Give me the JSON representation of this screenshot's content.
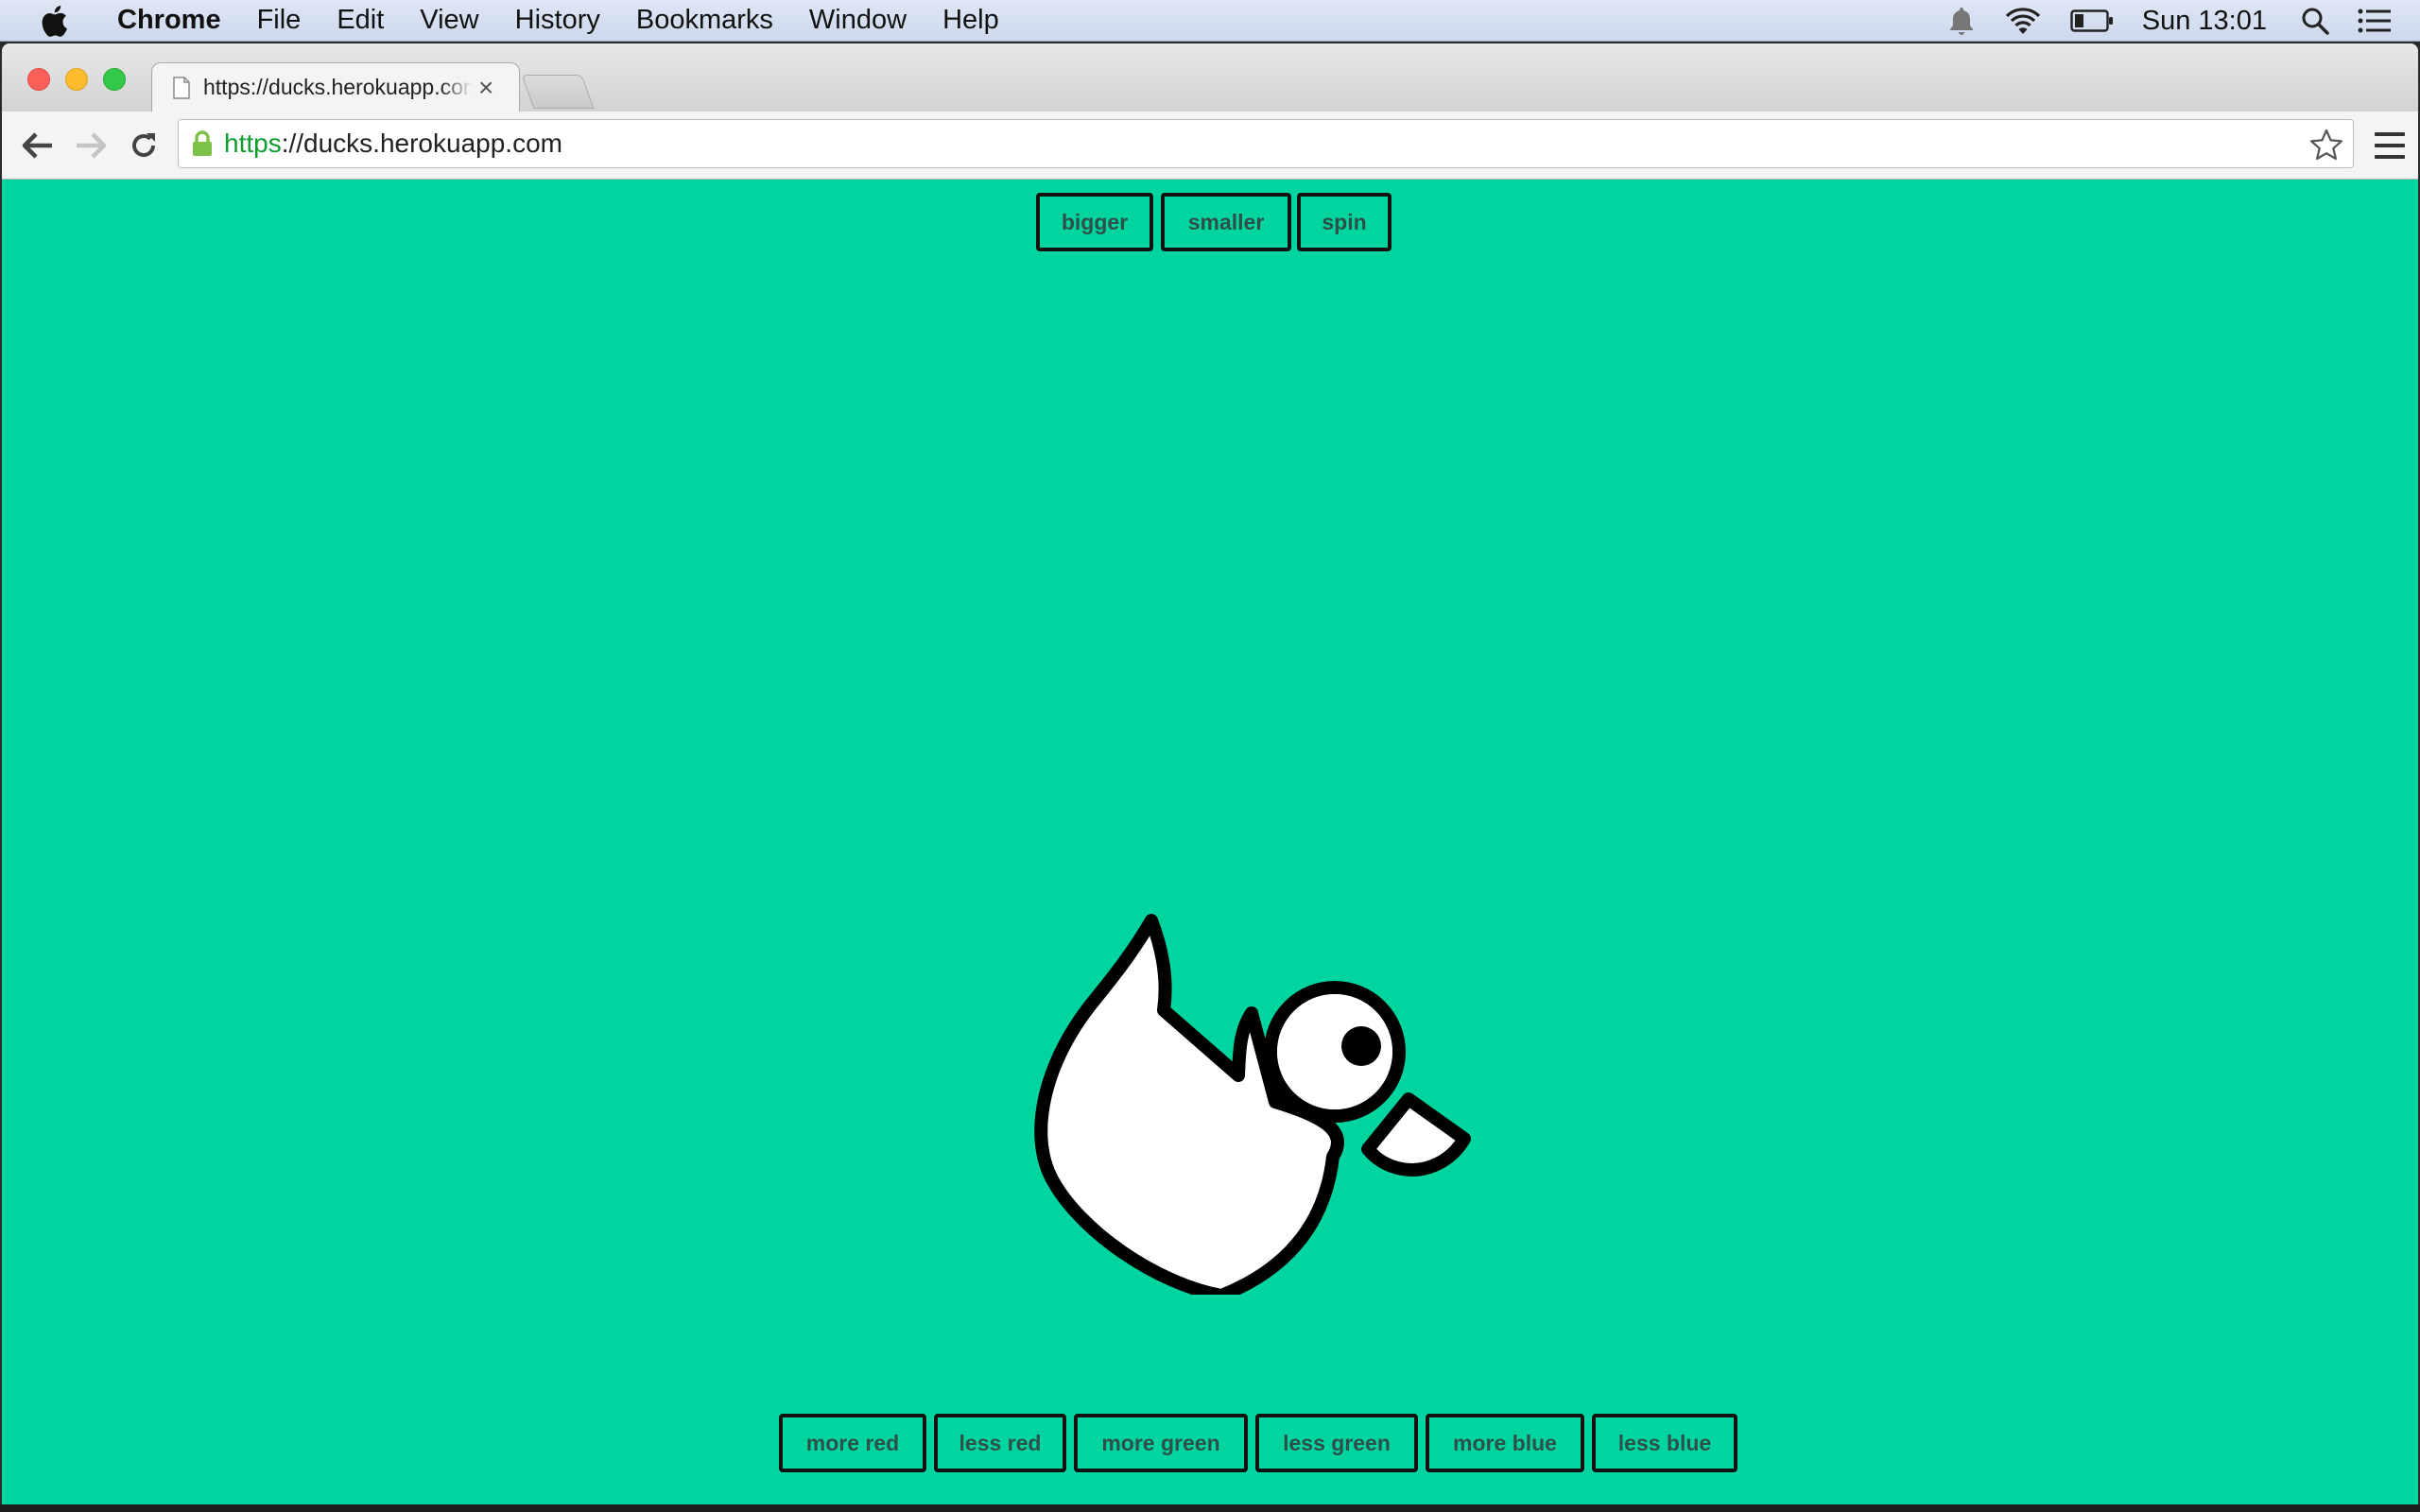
{
  "menubar": {
    "app_name": "Chrome",
    "items": [
      "File",
      "Edit",
      "View",
      "History",
      "Bookmarks",
      "Window",
      "Help"
    ],
    "clock": "Sun 13:01",
    "icons": [
      "apple-icon",
      "notification-bell-icon",
      "wifi-icon",
      "battery-icon",
      "spotlight-search-icon",
      "notification-center-icon"
    ]
  },
  "browser": {
    "tab_title": "https://ducks.herokuapp.com",
    "tab_close": "×",
    "url_scheme": "https",
    "url_rest": "://ducks.herokuapp.com",
    "icons": [
      "page-icon",
      "back-arrow-icon",
      "forward-arrow-icon",
      "reload-icon",
      "lock-icon",
      "bookmark-star-icon",
      "chrome-menu-icon"
    ]
  },
  "page": {
    "background_color": "#00d5a0",
    "top_controls": {
      "bigger": "bigger",
      "smaller": "smaller",
      "spin": "spin"
    },
    "color_controls": {
      "more_red": "more red",
      "less_red": "less red",
      "more_green": "more green",
      "less_green": "less green",
      "more_blue": "more blue",
      "less_blue": "less blue"
    },
    "duck": {
      "fill_color": "#ffffff",
      "outline_color": "#000000"
    }
  }
}
